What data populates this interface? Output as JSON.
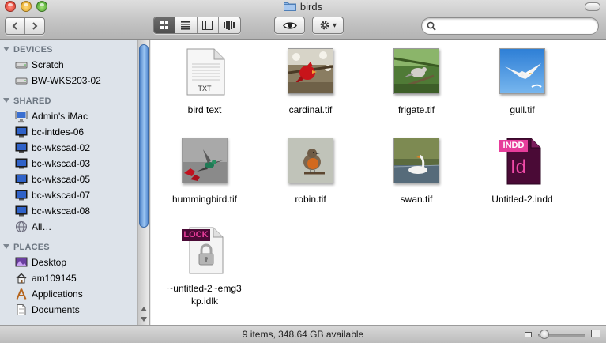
{
  "window": {
    "title": "birds",
    "accent_color": "#3875d7"
  },
  "toolbar": {
    "back_icon": "chevron-left",
    "forward_icon": "chevron-right",
    "view_modes": [
      "icon-view",
      "list-view",
      "column-view",
      "cover-flow-view"
    ],
    "selected_view": "icon-view",
    "quick_look_icon": "eye",
    "action_icon": "gear",
    "action_arrow": "▾",
    "search": {
      "value": "",
      "placeholder": ""
    }
  },
  "sidebar": {
    "sections": [
      {
        "title": "DEVICES",
        "items": [
          {
            "label": "Scratch",
            "icon": "harddrive-icon"
          },
          {
            "label": "BW-WKS203-02",
            "icon": "harddrive-icon"
          }
        ]
      },
      {
        "title": "SHARED",
        "items": [
          {
            "label": "Admin's iMac",
            "icon": "imac-icon"
          },
          {
            "label": "bc-intdes-06",
            "icon": "monitor-icon"
          },
          {
            "label": "bc-wkscad-02",
            "icon": "monitor-icon"
          },
          {
            "label": "bc-wkscad-03",
            "icon": "monitor-icon"
          },
          {
            "label": "bc-wkscad-05",
            "icon": "monitor-icon"
          },
          {
            "label": "bc-wkscad-07",
            "icon": "monitor-icon"
          },
          {
            "label": "bc-wkscad-08",
            "icon": "monitor-icon"
          },
          {
            "label": "All…",
            "icon": "network-globe-icon"
          }
        ]
      },
      {
        "title": "PLACES",
        "items": [
          {
            "label": "Desktop",
            "icon": "desktop-icon"
          },
          {
            "label": "am109145",
            "icon": "home-icon"
          },
          {
            "label": "Applications",
            "icon": "applications-icon"
          },
          {
            "label": "Documents",
            "icon": "documents-icon"
          }
        ]
      }
    ]
  },
  "files": [
    {
      "name": "bird text",
      "kind": "txt",
      "badge": "TXT"
    },
    {
      "name": "cardinal.tif",
      "kind": "photo-cardinal"
    },
    {
      "name": "frigate.tif",
      "kind": "photo-frigate"
    },
    {
      "name": "gull.tif",
      "kind": "photo-gull"
    },
    {
      "name": "hummingbird.tif",
      "kind": "photo-hummingbird"
    },
    {
      "name": "robin.tif",
      "kind": "photo-robin"
    },
    {
      "name": "swan.tif",
      "kind": "photo-swan"
    },
    {
      "name": "Untitled-2.indd",
      "kind": "indd",
      "badge": "INDD",
      "glyph": "Id"
    },
    {
      "name": "~untitled-2~emg3 kp.idlk",
      "kind": "lock",
      "badge": "LOCK"
    }
  ],
  "status": {
    "text": "9 items, 348.64 GB available",
    "zoom_level": 0.05
  }
}
